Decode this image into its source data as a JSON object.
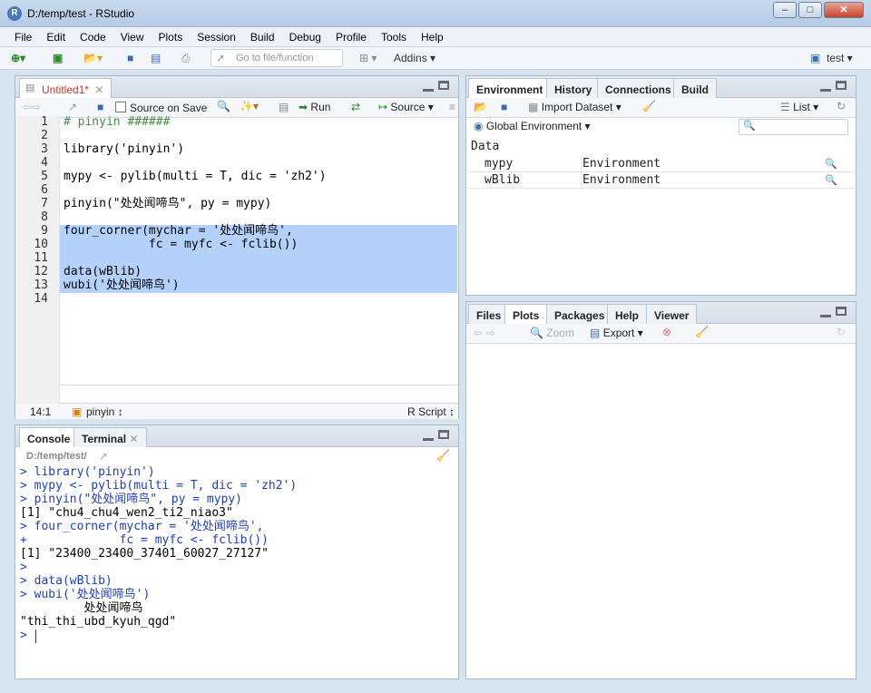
{
  "window": {
    "title": "D:/temp/test - RStudio",
    "min": "–",
    "max": "□",
    "close": "✕",
    "app_icon": "R"
  },
  "menu": [
    "File",
    "Edit",
    "Code",
    "View",
    "Plots",
    "Session",
    "Build",
    "Debug",
    "Profile",
    "Tools",
    "Help"
  ],
  "toolbar": {
    "goto_placeholder": "Go to file/function",
    "addins": "Addins",
    "project": "test"
  },
  "editor": {
    "tab": "Untitled1*",
    "source_on_save": "Source on Save",
    "run": "Run",
    "source": "Source",
    "lines": [
      "# pinyin ######",
      "",
      "library('pinyin')",
      "",
      "mypy <- pylib(multi = T, dic = 'zh2')",
      "",
      "pinyin(\"处处闻啼鸟\", py = mypy)",
      "",
      "four_corner(mychar = '处处闻啼鸟',",
      "            fc = myfc <- fclib())",
      "",
      "data(wBlib)",
      "wubi('处处闻啼鸟')",
      ""
    ],
    "line_numbers": [
      "1",
      "2",
      "3",
      "4",
      "5",
      "6",
      "7",
      "8",
      "9",
      "10",
      "11",
      "12",
      "13",
      "14"
    ],
    "status_pos": "14:1",
    "status_section": "pinyin",
    "status_type": "R Script"
  },
  "console": {
    "tabs": [
      "Console",
      "Terminal"
    ],
    "path": "D:/temp/test/",
    "lines": [
      {
        "t": "> library('pinyin')",
        "c": "blue"
      },
      {
        "t": "> mypy <- pylib(multi = T, dic = 'zh2')",
        "c": "blue"
      },
      {
        "t": "> pinyin(\"处处闻啼鸟\", py = mypy)",
        "c": "blue"
      },
      {
        "t": "[1] \"chu4_chu4_wen2_ti2_niao3\"",
        "c": "blk"
      },
      {
        "t": "> four_corner(mychar = '处处闻啼鸟',",
        "c": "blue"
      },
      {
        "t": "+             fc = myfc <- fclib())",
        "c": "blue"
      },
      {
        "t": "[1] \"23400_23400_37401_60027_27127\"",
        "c": "blk"
      },
      {
        "t": ">",
        "c": "blue"
      },
      {
        "t": "> data(wBlib)",
        "c": "blue"
      },
      {
        "t": "> wubi('处处闻啼鸟')",
        "c": "blue"
      },
      {
        "t": "         处处闻啼鸟",
        "c": "blk"
      },
      {
        "t": "\"thi_thi_ubd_kyuh_qgd\"",
        "c": "blk"
      },
      {
        "t": ">",
        "c": "blue"
      }
    ]
  },
  "env": {
    "tabs": [
      "Environment",
      "History",
      "Connections",
      "Build"
    ],
    "import": "Import Dataset",
    "view": "List",
    "scope": "Global Environment",
    "section": "Data",
    "rows": [
      {
        "name": "mypy",
        "value": "Environment"
      },
      {
        "name": "wBlib",
        "value": "Environment"
      }
    ]
  },
  "files": {
    "tabs": [
      "Files",
      "Plots",
      "Packages",
      "Help",
      "Viewer"
    ],
    "zoom": "Zoom",
    "export": "Export"
  },
  "colors": {
    "accent": "#4a79b8",
    "selection": "#b4d1fc"
  }
}
